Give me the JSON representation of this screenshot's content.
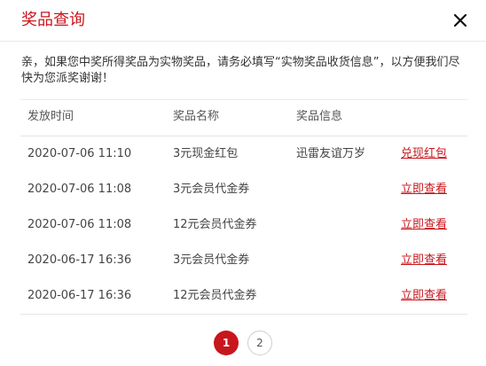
{
  "dialog": {
    "title": "奖品查询",
    "notice": "亲，如果您中奖所得奖品为实物奖品，请务必填写“实物奖品收货信息”，以方便我们尽快为您派奖谢谢！"
  },
  "table": {
    "headers": [
      "发放时间",
      "奖品名称",
      "奖品信息"
    ],
    "rows": [
      {
        "time": "2020-07-06 11:10",
        "name": "3元现金红包",
        "info": "迅雷友谊万岁",
        "action": "兑现红包"
      },
      {
        "time": "2020-07-06 11:08",
        "name": "3元会员代金券",
        "info": "",
        "action": "立即查看"
      },
      {
        "time": "2020-07-06 11:08",
        "name": "12元会员代金券",
        "info": "",
        "action": "立即查看"
      },
      {
        "time": "2020-06-17 16:36",
        "name": "3元会员代金券",
        "info": "",
        "action": "立即查看"
      },
      {
        "time": "2020-06-17 16:36",
        "name": "12元会员代金券",
        "info": "",
        "action": "立即查看"
      }
    ]
  },
  "pagination": {
    "pages": [
      "1",
      "2"
    ],
    "current": "1"
  },
  "colors": {
    "accent": "#c8161d"
  },
  "icons": {
    "close": "close-icon"
  }
}
